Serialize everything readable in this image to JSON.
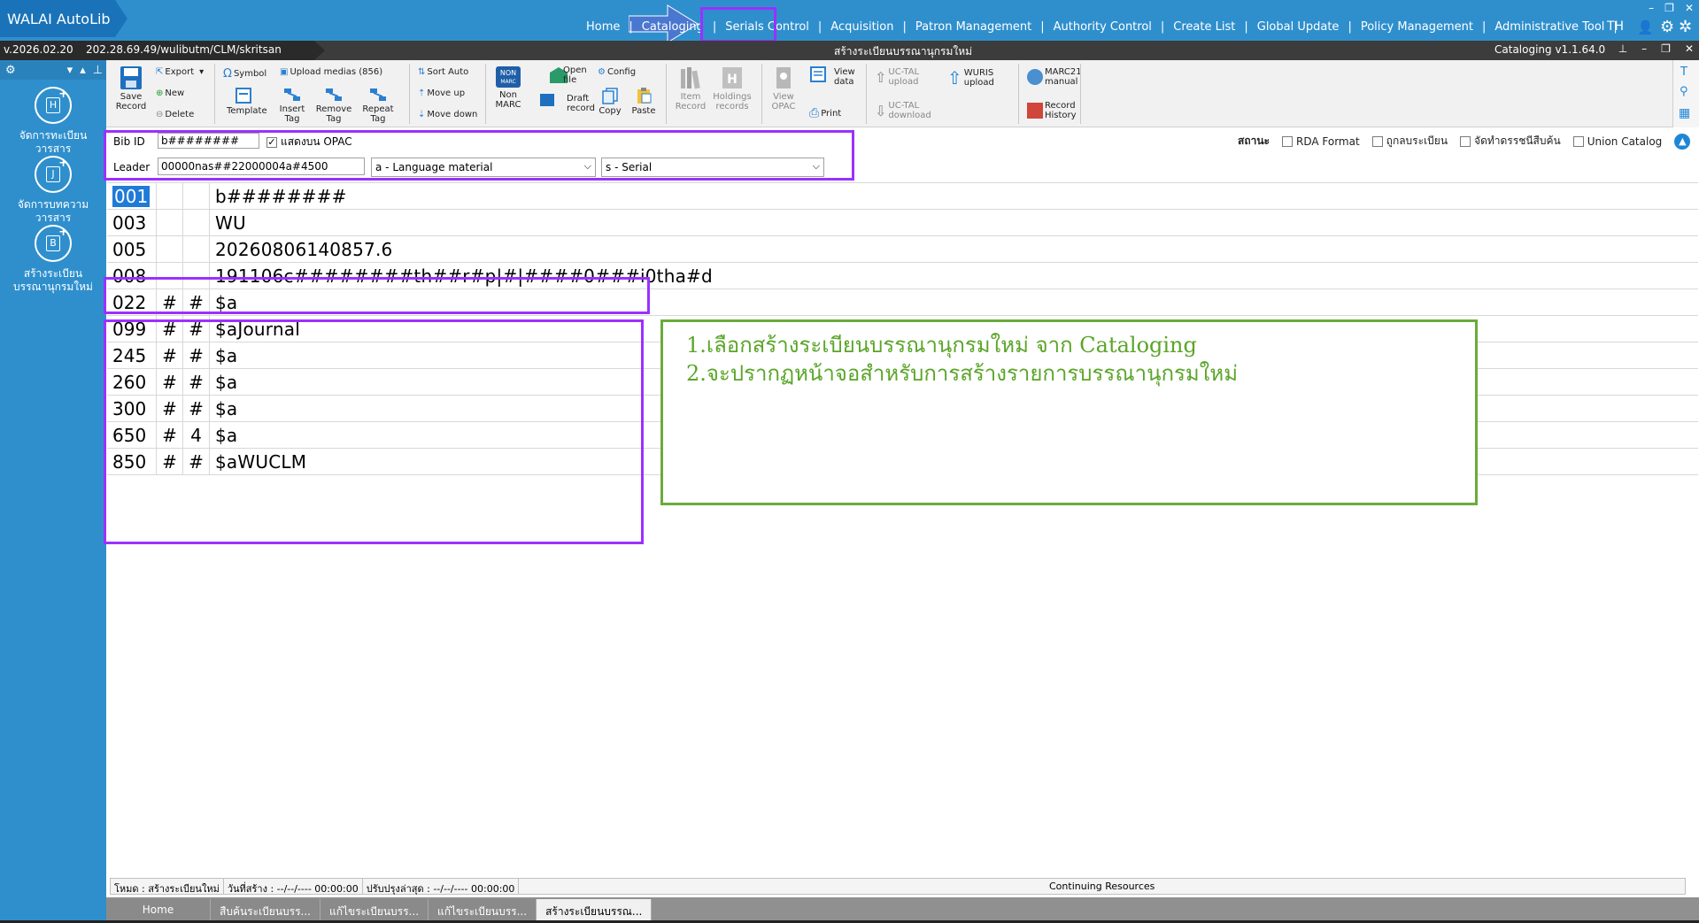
{
  "app": {
    "logo": "WALAI AutoLib",
    "version": "v.2026.02.20",
    "host": "202.28.69.49/wulibutm/CLM/skritsan",
    "window_title": "สร้างระเบียนบรรณานุกรมใหม่",
    "module_version": "Cataloging v1.1.64.0",
    "language": "TH"
  },
  "topmenu": [
    {
      "label": "Home"
    },
    {
      "label": "Cataloging"
    },
    {
      "label": "Serials Control"
    },
    {
      "label": "Acquisition"
    },
    {
      "label": "Patron Management"
    },
    {
      "label": "Authority Control"
    },
    {
      "label": "Create List"
    },
    {
      "label": "Global Update"
    },
    {
      "label": "Policy Management"
    },
    {
      "label": "Administrative Tool"
    }
  ],
  "sidebar": {
    "items": [
      {
        "letter": "H",
        "line1": "จัดการทะเบียน",
        "line2": "วารสาร"
      },
      {
        "letter": "J",
        "line1": "จัดการบทความ",
        "line2": "วารสาร"
      },
      {
        "letter": "B",
        "line1": "สร้างระเบียน",
        "line2": "บรรณานุกรมใหม่"
      }
    ]
  },
  "toolbar": {
    "save": "Save Record",
    "save_l1": "Save",
    "save_l2": "Record",
    "export": "Export",
    "new": "New",
    "delete": "Delete",
    "symbol": "Symbol",
    "upload_medias": "Upload medias (856)",
    "template": "Template",
    "insert_l1": "Insert",
    "insert_l2": "Tag",
    "remove_l1": "Remove",
    "remove_l2": "Tag",
    "repeat_l1": "Repeat",
    "repeat_l2": "Tag",
    "sort_auto": "Sort Auto",
    "move_up": "Move up",
    "move_down": "Move down",
    "non_marc_l1": "Non",
    "non_marc_l2": "MARC",
    "open_l1": "Open",
    "open_l2": "file",
    "config": "Config",
    "draft_l1": "Draft",
    "draft_l2": "record",
    "copy": "Copy",
    "paste": "Paste",
    "item_l1": "Item",
    "item_l2": "Record",
    "holdings_l1": "Holdings",
    "holdings_l2": "records",
    "viewopac_l1": "View",
    "viewopac_l2": "OPAC",
    "viewdata_l1": "View",
    "viewdata_l2": "data",
    "print": "Print",
    "uctal_up_l1": "UC-TAL",
    "uctal_up_l2": "upload",
    "uctal_down_l1": "UC-TAL",
    "uctal_down_l2": "download",
    "wuris_l1": "WURIS",
    "wuris_l2": "upload",
    "marc21_l1": "MARC21",
    "marc21_l2": "manual",
    "history_l1": "Record",
    "history_l2": "History"
  },
  "header": {
    "bib_id_label": "Bib ID",
    "bib_id_value": "b########",
    "opac_label": "แสดงบน OPAC",
    "leader_label": "Leader",
    "leader_value": "00000nas##22000004a#4500",
    "type_select": "a - Language material",
    "level_select": "s - Serial"
  },
  "status": {
    "label": "สถานะ",
    "rda": "RDA Format",
    "suppressed": "ถูกลบระเบียน",
    "index": "จัดทำดรรชนีสืบค้น",
    "union": "Union Catalog"
  },
  "marc_rows": [
    {
      "tag": "001",
      "i1": "",
      "i2": "",
      "value": "b########"
    },
    {
      "tag": "003",
      "i1": "",
      "i2": "",
      "value": "WU"
    },
    {
      "tag": "005",
      "i1": "",
      "i2": "",
      "value": "20260806140857.6"
    },
    {
      "tag": "008",
      "i1": "",
      "i2": "",
      "value": "191106c########th##r#p|#|####0###i0tha#d"
    },
    {
      "tag": "022",
      "i1": "#",
      "i2": "#",
      "value": "$a"
    },
    {
      "tag": "099",
      "i1": "#",
      "i2": "#",
      "value": "$aJournal"
    },
    {
      "tag": "245",
      "i1": "#",
      "i2": "#",
      "value": "$a"
    },
    {
      "tag": "260",
      "i1": "#",
      "i2": "#",
      "value": "$a"
    },
    {
      "tag": "300",
      "i1": "#",
      "i2": "#",
      "value": "$a"
    },
    {
      "tag": "650",
      "i1": "#",
      "i2": "4",
      "value": "$a"
    },
    {
      "tag": "850",
      "i1": "#",
      "i2": "#",
      "value": "$aWUCLM"
    }
  ],
  "note": {
    "line1": "1.เลือกสร้างระเบียนบรรณานุกรมใหม่ จาก Cataloging",
    "line2": "2.จะปรากฏหน้าจอสำหรับการสร้างรายการบรรณานุกรมใหม่"
  },
  "statusbar": {
    "mode": "โหมด : สร้างระเบียนใหม่",
    "created": "วันที่สร้าง :  --/--/---- 00:00:00",
    "updated": "ปรับปรุงล่าสุด :  --/--/---- 00:00:00",
    "resource": "Continuing Resources"
  },
  "tabs": [
    {
      "label": "Home",
      "active": false
    },
    {
      "label": "สืบค้นระเบียนบรร...",
      "active": false
    },
    {
      "label": "แก้ไขระเบียนบรร...",
      "active": false
    },
    {
      "label": "แก้ไขระเบียนบรร...",
      "active": false
    },
    {
      "label": "สร้างระเบียนบรรณ...",
      "active": true
    }
  ],
  "colors": {
    "topbar": "#2f8fcd",
    "highlight": "#9b30ff",
    "note_border": "#6aab3c",
    "note_text": "#5aa528"
  }
}
